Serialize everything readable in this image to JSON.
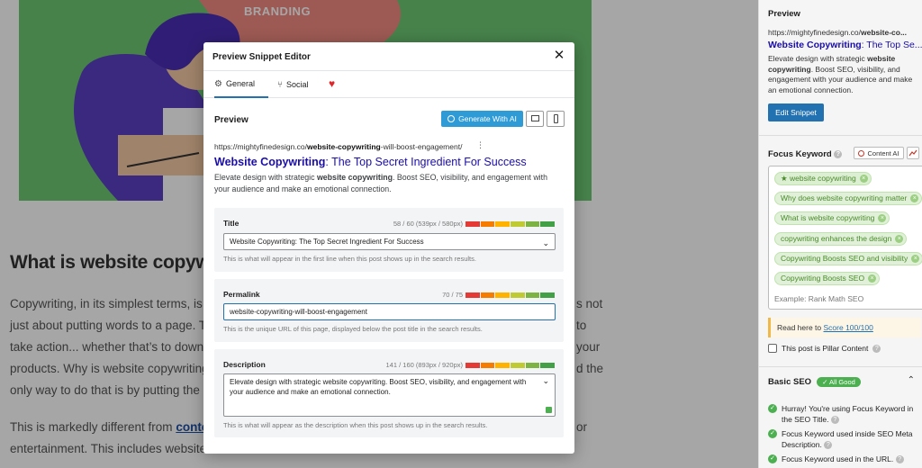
{
  "article": {
    "hero_text": "BRANDING",
    "heading": "What is website copyw",
    "p1_lines": [
      "Copywriting, in its simplest terms, is t",
      "just about putting words to a page. Th",
      "take action... whether that’s to downlo",
      "products. Why is website copywriting",
      "only way to do that is by putting the r"
    ],
    "right_fragments": [
      "s not",
      "to",
      "your",
      "d the"
    ],
    "p2_line1_start": "This is markedly different from ",
    "p2_link": "conte",
    "p2_line1_end": "or",
    "p2_line2": "entertainment. This includes website"
  },
  "sidebar": {
    "preview_label": "Preview",
    "url_prefix": "https://mightyfinedesign.co/",
    "url_bold": "website-co...",
    "title_bold": "Website Copywriting",
    "title_rest": ": The Top Se...",
    "desc_1": "Elevate design with strategic ",
    "desc_bold": "website copywriting",
    "desc_2": ". Boost SEO, visibility, and engagement with your audience and make an emotional connection.",
    "edit_snippet": "Edit Snippet",
    "focus_keyword_label": "Focus Keyword",
    "content_ai_label": "Content AI",
    "keywords": [
      "website copywriting",
      "Why does website copywriting matter",
      "What is website copywriting",
      "copywriting enhances the design",
      "Copywriting Boosts SEO and visibility",
      "Copywriting Boosts SEO"
    ],
    "keyword_placeholder": "Example: Rank Math SEO",
    "score_text": "Read here to ",
    "score_link": "Score 100/100",
    "pillar_label": "This post is Pillar Content",
    "basic_seo_label": "Basic SEO",
    "all_good_badge": "✓ All Good",
    "checks": [
      "Hurray! You're using Focus Keyword in the SEO Title.",
      "Focus Keyword used inside SEO Meta Description.",
      "Focus Keyword used in the URL."
    ]
  },
  "modal": {
    "title": "Preview Snippet Editor",
    "tabs": {
      "general": "General",
      "social": "Social"
    },
    "preview_label": "Preview",
    "generate_ai": "Generate With AI",
    "snippet": {
      "url_prefix": "https://mightyfinedesign.co/",
      "url_bold": "website-copywriting",
      "url_suffix": "-will-boost-engagement/",
      "title_bold": "Website Copywriting",
      "title_rest": ": The Top Secret Ingredient For Success",
      "desc_1": "Elevate design with strategic ",
      "desc_bold": "website copywriting",
      "desc_2": ". Boost SEO, visibility, and engagement with your audience and make an emotional connection."
    },
    "fields": {
      "title": {
        "label": "Title",
        "count": "58 / 60 (539px / 580px)",
        "value": "Website Copywriting: The Top Secret Ingredient For Success",
        "help": "This is what will appear in the first line when this post shows up in the search results."
      },
      "permalink": {
        "label": "Permalink",
        "count": "70 / 75",
        "value": "website-copywriting-will-boost-engagement",
        "help": "This is the unique URL of this page, displayed below the post title in the search results."
      },
      "description": {
        "label": "Description",
        "count": "141 / 160 (893px / 920px)",
        "value": "Elevate design with strategic website copywriting. Boost SEO, visibility, and engagement with your audience and make an emotional connection.",
        "help": "This is what will appear as the description when this post shows up in the search results."
      }
    }
  },
  "colors": {
    "accent": "#2271b1",
    "ai_button": "#2e9bd6",
    "serp_title": "#1a0dab",
    "good": "#4caf50",
    "meter": [
      "#e53935",
      "#f57c00",
      "#ffb300",
      "#c0ca33",
      "#7cb342",
      "#43a047"
    ]
  }
}
